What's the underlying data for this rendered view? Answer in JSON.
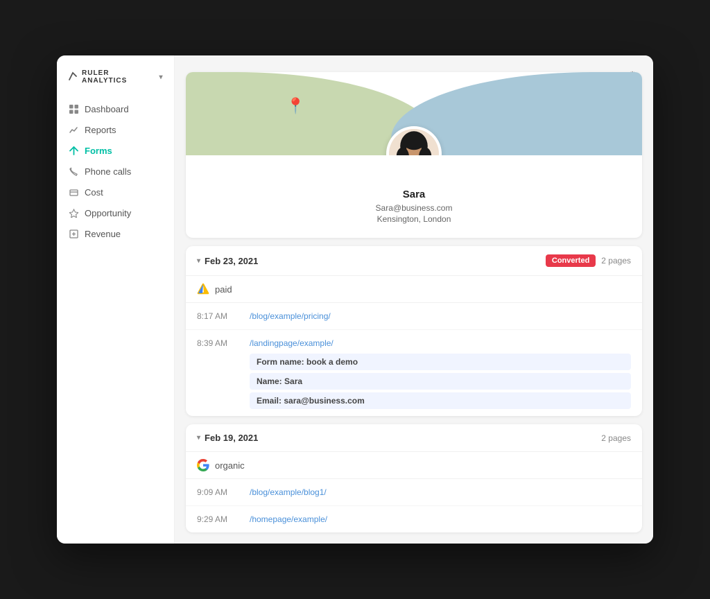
{
  "app": {
    "name": "RULER ANALYTICS",
    "gear_label": "⚙"
  },
  "sidebar": {
    "items": [
      {
        "id": "dashboard",
        "label": "Dashboard",
        "icon": "grid",
        "active": false
      },
      {
        "id": "reports",
        "label": "Reports",
        "icon": "bar-chart",
        "active": false
      },
      {
        "id": "forms",
        "label": "Forms",
        "icon": "form",
        "active": true
      },
      {
        "id": "phone-calls",
        "label": "Phone calls",
        "icon": "phone",
        "active": false
      },
      {
        "id": "cost",
        "label": "Cost",
        "icon": "cost",
        "active": false
      },
      {
        "id": "opportunity",
        "label": "Opportunity",
        "icon": "funnel",
        "active": false
      },
      {
        "id": "revenue",
        "label": "Revenue",
        "icon": "revenue",
        "active": false
      }
    ]
  },
  "profile": {
    "name": "Sara",
    "email": "Sara@business.com",
    "location": "Kensington, London",
    "avatar_alt": "Sara profile picture"
  },
  "sessions": [
    {
      "id": "session1",
      "date": "Feb 23, 2021",
      "converted": true,
      "converted_label": "Converted",
      "pages": "2 pages",
      "source": "paid",
      "source_type": "ads",
      "rows": [
        {
          "time": "8:17 AM",
          "url": "/blog/example/pricing/",
          "form": null
        },
        {
          "time": "8:39 AM",
          "url": "/landingpage/example/",
          "form": {
            "form_name_label": "Form name:",
            "form_name_value": "book a demo",
            "name_label": "Name:",
            "name_value": "Sara",
            "email_label": "Email:",
            "email_value": "sara@business.com"
          }
        }
      ]
    },
    {
      "id": "session2",
      "date": "Feb 19, 2021",
      "converted": false,
      "pages": "2 pages",
      "source": "organic",
      "source_type": "google",
      "rows": [
        {
          "time": "9:09 AM",
          "url": "/blog/example/blog1/",
          "form": null
        },
        {
          "time": "9:29 AM",
          "url": "/homepage/example/",
          "form": null
        }
      ]
    }
  ]
}
